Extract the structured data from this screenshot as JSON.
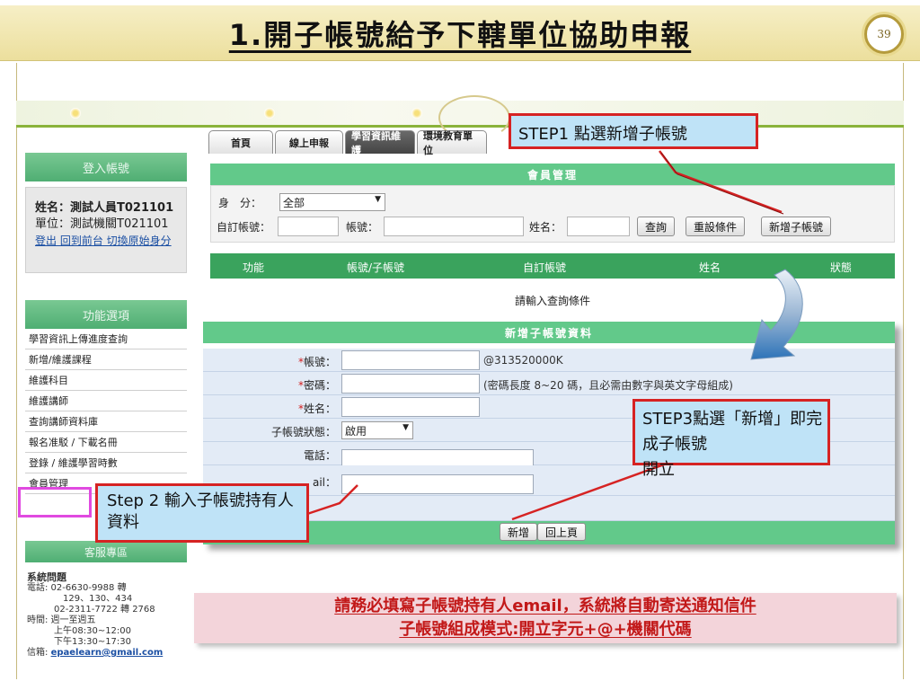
{
  "slide": {
    "title": "1.開子帳號給予下轄單位協助申報",
    "page_number": "39"
  },
  "tabs": [
    "首頁",
    "線上申報",
    "學習資訊維護",
    "環境教育單位"
  ],
  "sidebar": {
    "login_title": "登入帳號",
    "name_line": "姓名：測試人員T021101",
    "unit_line": "單位：測試機關T021101",
    "links": "登出 回到前台 切換原始身分",
    "menu_title": "功能選項",
    "menu_items": [
      "學習資訊上傳進度查詢",
      "新增/維護課程",
      "維護科目",
      "維護講師",
      "查詢講師資料庫",
      "報名准駁 / 下載名冊",
      "登錄 / 維護學習時數",
      "會員管理"
    ],
    "service_title": "客服專區",
    "service_lines": {
      "system_issue": "系統問題",
      "phone1": "電話: 02-6630-9988 轉",
      "ext1": "129、130、434",
      "phone2": "02-2311-7722 轉 2768",
      "hours": "時間: 週一至週五",
      "am": "上午08:30~12:00",
      "pm": "下午13:30~17:30",
      "mail_label": "信箱:",
      "mail": "epaelearn@gmail.com"
    }
  },
  "member_panel": {
    "title": "會員管理",
    "identity_label": "身　分：",
    "identity_value": "全部",
    "custom_account_label": "自訂帳號：",
    "account_label": "帳號：",
    "name_label": "姓名：",
    "buttons": {
      "query": "查詢",
      "reset": "重設條件",
      "add_sub": "新增子帳號"
    },
    "columns": [
      "功能",
      "帳號/子帳號",
      "自訂帳號",
      "姓名",
      "狀態"
    ],
    "hint": "請輸入查詢條件"
  },
  "new_form": {
    "title": "新增子帳號資料",
    "account_label": "帳號：",
    "account_suffix": "@313520000K",
    "password_label": "密碼：",
    "password_note": "(密碼長度 8~20 碼，且必需由數字與英文字母組成)",
    "name_label": "姓名：",
    "status_label": "子帳號狀態：",
    "status_value": "啟用",
    "phone_label": "電話：",
    "email_label": "ail：",
    "required_mark": "*",
    "buttons": {
      "add": "新增",
      "back": "回上頁"
    }
  },
  "callouts": {
    "step1": "STEP1 點選新增子帳號",
    "step2": "Step 2 輸入子帳號持有人資料",
    "step3_main": "STEP3點選「新增」即完成子帳號",
    "step3_overflow": "開立"
  },
  "bottom_note": {
    "line1": "請務必填寫子帳號持有人email，系統將自動寄送通知信件",
    "line2": "子帳號組成模式:開立字元+@+機關代碼"
  },
  "colors": {
    "header_green": "#62c98a",
    "column_green": "#3aa35d",
    "callout_border": "#d62323",
    "callout_fill": "#bfe3f7",
    "menu_highlight": "#e04ae0",
    "note_text": "#c21818"
  }
}
